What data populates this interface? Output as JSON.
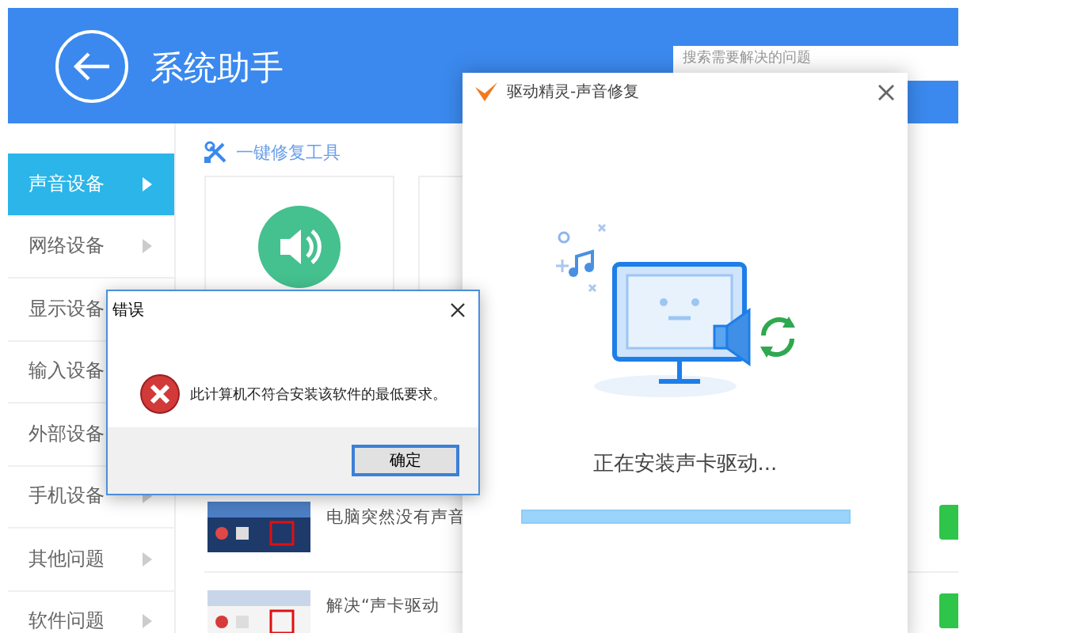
{
  "app": {
    "title": "系统助手",
    "search": {
      "placeholder": "搜索需要解决的问题"
    }
  },
  "sidebar": {
    "items": [
      {
        "label": "声音设备",
        "selected": true
      },
      {
        "label": "网络设备",
        "selected": false
      },
      {
        "label": "显示设备",
        "selected": false
      },
      {
        "label": "输入设备",
        "selected": false
      },
      {
        "label": "外部设备",
        "selected": false
      },
      {
        "label": "手机设备",
        "selected": false
      },
      {
        "label": "其他问题",
        "selected": false
      },
      {
        "label": "软件问题",
        "selected": false
      }
    ]
  },
  "tools": {
    "heading": "一键修复工具"
  },
  "articles": [
    {
      "title": "电脑突然没有声音"
    },
    {
      "title": "解决“声卡驱动"
    }
  ],
  "repair_dialog": {
    "title": "驱动精灵-声音修复",
    "status": "正在安装声卡驱动...",
    "level": 1
  },
  "error_dialog": {
    "title": "错误",
    "message": "此计算机不符合安装该软件的最低要求。",
    "button": "确定"
  }
}
